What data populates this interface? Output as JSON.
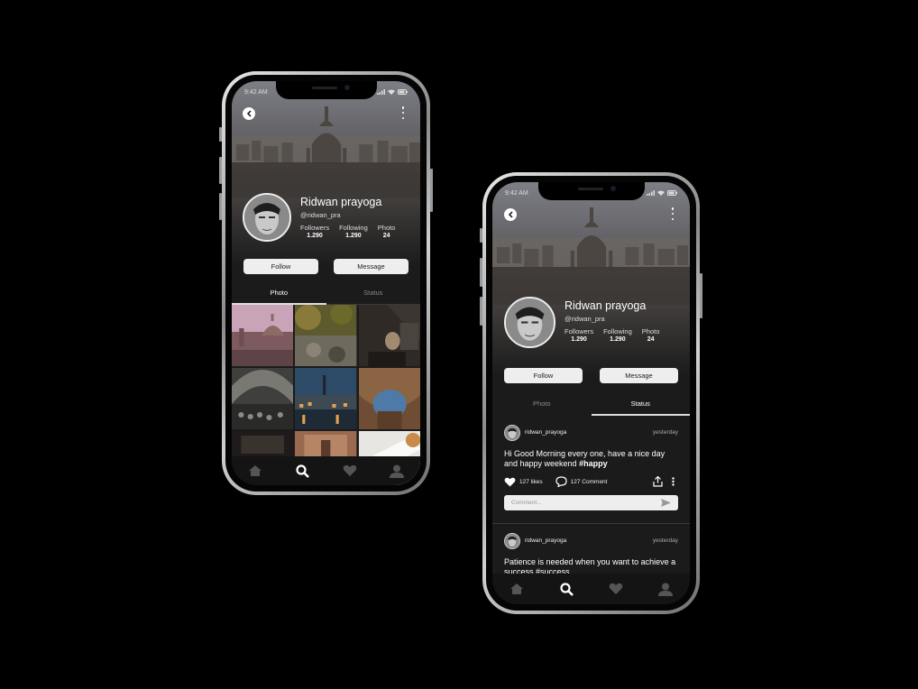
{
  "status_time": "9:42 AM",
  "profile": {
    "name": "Ridwan prayoga",
    "handle": "@ridwan_pra",
    "stats": [
      {
        "label": "Followers",
        "value": "1.290"
      },
      {
        "label": "Following",
        "value": "1.290"
      },
      {
        "label": "Photo",
        "value": "24"
      }
    ],
    "follow_label": "Follow",
    "message_label": "Message"
  },
  "tabs": [
    "Photo",
    "Status"
  ],
  "left_active_tab": "Photo",
  "right_active_tab": "Status",
  "nav_icons": [
    "home-icon",
    "search-icon",
    "heart-icon",
    "user-icon"
  ],
  "posts": [
    {
      "user": "ridwan_prayoga",
      "time": "yesterday",
      "text": "Hi Good Morning every one, have a nice day and happy weekend",
      "hashtag": "#happy",
      "likes": "127 likes",
      "comments": "127 Comment",
      "comment_placeholder": "Comment..."
    },
    {
      "user": "ridwan_prayoga",
      "time": "yesterday",
      "text": "Patience is needed when you want to achieve a success",
      "hashtag": "#success"
    }
  ],
  "colors": {
    "background": "#000000",
    "screen": "#1b1b1b",
    "button": "#eeeeee",
    "nav_active": "#ffffff",
    "nav_inactive": "#555555"
  }
}
